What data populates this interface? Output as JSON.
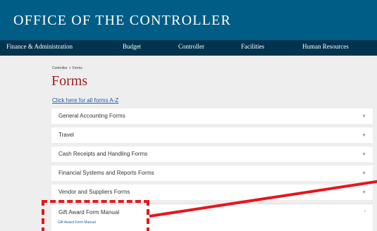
{
  "header": {
    "title": "Office of the Controller"
  },
  "nav": {
    "items": [
      "Finance & Administration",
      "Budget",
      "Controller",
      "Facilities",
      "Human Resources"
    ]
  },
  "breadcrumb": {
    "home": "Controller",
    "separator": ">",
    "current": "Forms"
  },
  "page": {
    "title": "Forms",
    "az_link": "Click here for all forms A-Z"
  },
  "accordion": [
    {
      "label": "General Accounting Forms",
      "toggle": "+"
    },
    {
      "label": "Travel",
      "toggle": "+"
    },
    {
      "label": "Cash Receipts and Handling Forms",
      "toggle": "+"
    },
    {
      "label": "Financial Systems and Reports Forms",
      "toggle": "+"
    },
    {
      "label": "Vendor and Suppliers Forms",
      "toggle": "+"
    }
  ],
  "expanded": {
    "label": "Gift Award Form Manual",
    "toggle": "-",
    "links": [
      "Gift Award Form Manual"
    ]
  },
  "annotation": {
    "color": "#e8151b"
  },
  "colors": {
    "header": "#005d86",
    "nav": "#00344f",
    "title": "#9e1b1b",
    "link": "#1d5fa8"
  }
}
